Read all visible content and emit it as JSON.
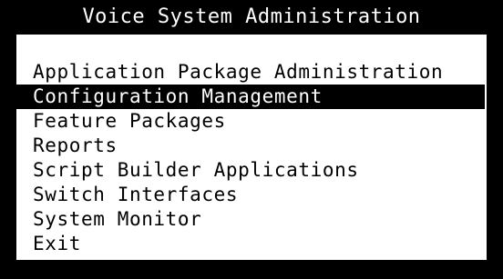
{
  "window": {
    "title": "Voice System Administration"
  },
  "menu": {
    "selected_index": 1,
    "items": [
      {
        "label": "Application Package Administration"
      },
      {
        "label": "Configuration Management"
      },
      {
        "label": "Feature Packages"
      },
      {
        "label": "Reports"
      },
      {
        "label": "Script Builder Applications"
      },
      {
        "label": "Switch Interfaces"
      },
      {
        "label": "System Monitor"
      },
      {
        "label": "Exit"
      }
    ]
  },
  "colors": {
    "background": "#000000",
    "panel": "#ffffff",
    "text": "#000000",
    "highlight_bg": "#000000",
    "highlight_text": "#ffffff"
  }
}
